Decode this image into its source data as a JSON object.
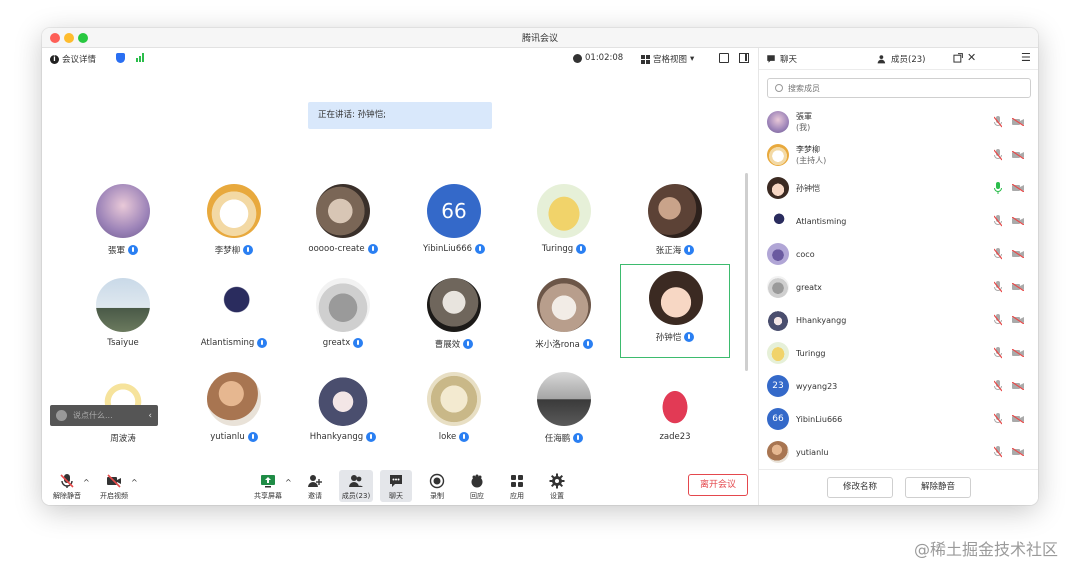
{
  "window": {
    "title": "腾讯会议"
  },
  "topbar": {
    "meeting_info": "会议详情",
    "duration": "01:02:08",
    "view_mode": "宫格视图"
  },
  "speaking": "正在讲话: 孙钟恺;",
  "participants": [
    {
      "name": "張軍"
    },
    {
      "name": "李梦柳"
    },
    {
      "name": "ooooo-create"
    },
    {
      "name": "YibinLiu666",
      "initials": "66"
    },
    {
      "name": "Turingg"
    },
    {
      "name": "张正海"
    },
    {
      "name": "Tsaiyue"
    },
    {
      "name": "Atlantisming"
    },
    {
      "name": "greatx"
    },
    {
      "name": "曹展效"
    },
    {
      "name": "米小洛rona"
    },
    {
      "name": "孙钟恺"
    },
    {
      "name": "周波涛"
    },
    {
      "name": "yutianlu"
    },
    {
      "name": "Hhankyangg"
    },
    {
      "name": "loke"
    },
    {
      "name": "任海鹏"
    },
    {
      "name": "zade23"
    }
  ],
  "chat_input": {
    "placeholder": "说点什么..."
  },
  "bottombar": {
    "unmute": "解除静音",
    "start_video": "开启视频",
    "share_screen": "共享屏幕",
    "invite": "邀请",
    "members": "成员(23)",
    "chat": "聊天",
    "record": "录制",
    "react": "回应",
    "apps": "应用",
    "settings": "设置",
    "leave": "离开会议"
  },
  "panel": {
    "chat_tab": "聊天",
    "members_tab": "成员(23)",
    "search_placeholder": "搜索成员",
    "members": [
      {
        "name": "張軍",
        "role": "(我)"
      },
      {
        "name": "李梦柳",
        "role": "(主持人)"
      },
      {
        "name": "孙钟恺"
      },
      {
        "name": "Atlantisming"
      },
      {
        "name": "coco"
      },
      {
        "name": "greatx"
      },
      {
        "name": "Hhankyangg"
      },
      {
        "name": "Turingg"
      },
      {
        "name": "wyyang23",
        "initials": "23"
      },
      {
        "name": "YibinLiu666",
        "initials": "66"
      },
      {
        "name": "yutianlu"
      }
    ],
    "rename_button": "修改名称",
    "unmute_button": "解除静音"
  },
  "watermark": "@稀土掘金技术社区",
  "colors": {
    "accent_blue": "#2a7ff2",
    "active_speaker_border": "#3dbb6e",
    "leave_red": "#e4484d",
    "speaking_mic_green": "#2cbd4c",
    "muted_red": "#e84a4a"
  }
}
